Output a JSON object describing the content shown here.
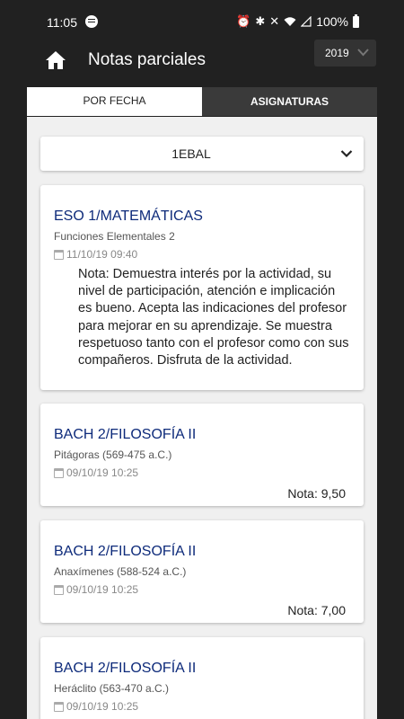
{
  "status_bar": {
    "time": "11:05",
    "battery": "100%",
    "icons": [
      "spotify-icon",
      "alarm-icon",
      "bluetooth-icon",
      "mute-icon",
      "wifi-icon",
      "signal-icon",
      "battery-icon"
    ]
  },
  "app_bar": {
    "title": "Notas parciales",
    "year": "2019"
  },
  "tabs": [
    {
      "label": "POR FECHA",
      "active": true
    },
    {
      "label": "ASIGNATURAS",
      "active": false
    }
  ],
  "filter": {
    "selected": "1EBAL"
  },
  "cards": [
    {
      "title": "ESO 1/MATEMÁTICAS",
      "subtitle": "Funciones Elementales 2",
      "date": "11/10/19 09:40",
      "note": "Nota: Demuestra interés por la actividad, su nivel de participación, atención e implicación es bueno. Acepta las indicaciones del profesor para mejorar en su aprendizaje. Se muestra respetuoso tanto con el profesor como con sus compañeros. Disfruta de la actividad."
    },
    {
      "title": "BACH 2/FILOSOFÍA II",
      "subtitle": "Pitágoras (569-475 a.C.)",
      "date": "09/10/19 10:25",
      "grade_label": "Nota:",
      "grade_value": "9,50"
    },
    {
      "title": "BACH 2/FILOSOFÍA II",
      "subtitle": "Anaxímenes (588-524 a.C.)",
      "date": "09/10/19 10:25",
      "grade_label": "Nota:",
      "grade_value": "7,00"
    },
    {
      "title": "BACH 2/FILOSOFÍA II",
      "subtitle": "Heráclito (563-470 a.C.)",
      "date": "09/10/19 10:25"
    }
  ],
  "colors": {
    "background": "#212121",
    "title_blue": "#0d2a7a",
    "content_bg": "#f0f0f0"
  }
}
